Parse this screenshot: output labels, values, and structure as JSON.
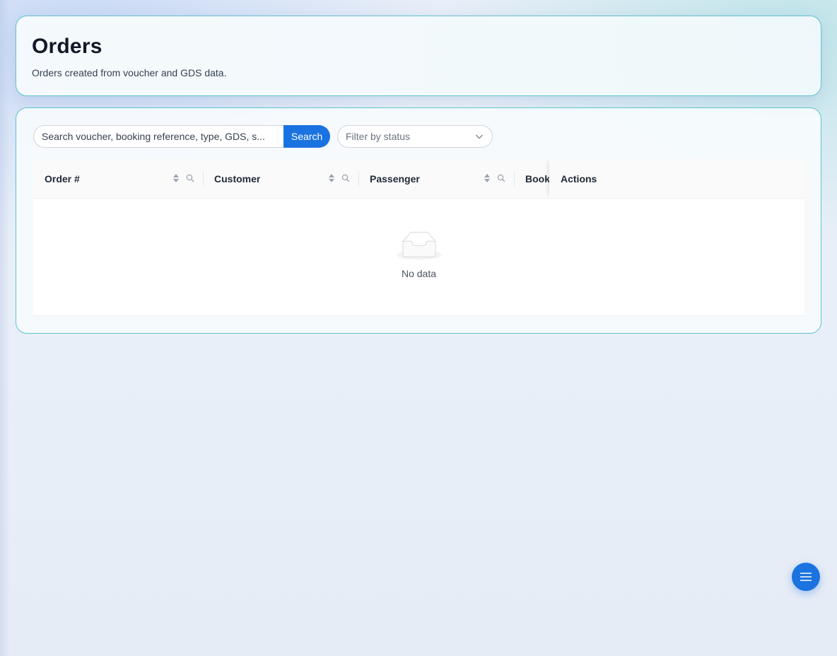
{
  "header": {
    "title": "Orders",
    "subtitle": "Orders created from voucher and GDS data."
  },
  "toolbar": {
    "search_placeholder": "Search voucher, booking reference, type, GDS, s...",
    "search_button_label": "Search",
    "status_filter_placeholder": "Filter by status"
  },
  "table": {
    "columns": [
      {
        "label": "Order #",
        "sortable": true,
        "filterable": true
      },
      {
        "label": "Customer",
        "sortable": true,
        "filterable": true
      },
      {
        "label": "Passenger",
        "sortable": true,
        "filterable": true
      },
      {
        "label": "Booki",
        "sortable": false,
        "filterable": false
      },
      {
        "label": "Actions",
        "sortable": false,
        "filterable": false
      }
    ],
    "rows": [],
    "empty_text": "No data"
  },
  "icons": {
    "sort": "sort-icon",
    "filter": "search-icon",
    "dropdown": "chevron-down-icon",
    "empty": "empty-inbox-icon",
    "fab": "menu-icon"
  },
  "colors": {
    "accent": "#1a73e0",
    "card_border": "#5ec3cf"
  }
}
